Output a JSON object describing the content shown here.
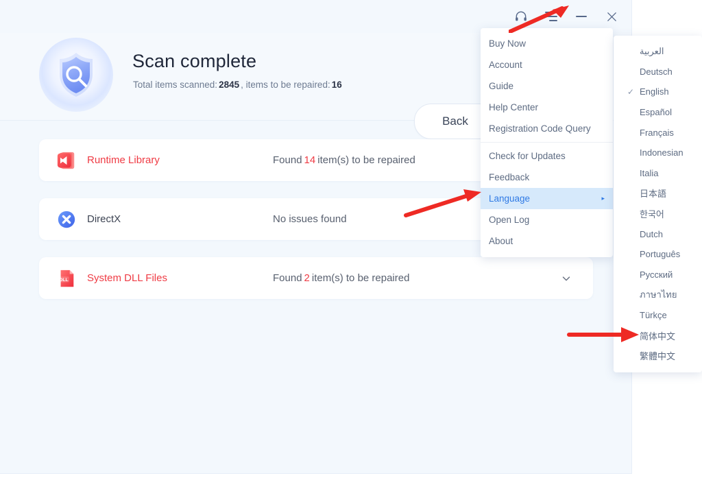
{
  "app": {
    "titlebar": {
      "support_icon": "headset-icon",
      "menu_icon": "hamburger-menu-icon",
      "minimize_icon": "minimize-icon",
      "close_icon": "close-icon"
    },
    "hero": {
      "logo_icon": "shield-scan-icon",
      "title": "Scan complete",
      "scanned_label": "Total items scanned:",
      "scanned_value": "2845",
      "comma": ",",
      "repair_label": "items to be repaired:",
      "repair_value": "16",
      "back_label": "Back"
    },
    "results": [
      {
        "icon": "visual-studio-runtime-icon",
        "name": "Runtime Library",
        "state": "alert",
        "status_prefix": "Found",
        "count": "14",
        "status_suffix": "item(s) to be repaired",
        "has_chevron": false
      },
      {
        "icon": "directx-icon",
        "name": "DirectX",
        "state": "ok",
        "status_prefix": "No issues found",
        "count": "",
        "status_suffix": "",
        "has_chevron": false
      },
      {
        "icon": "dll-file-icon",
        "name": "System DLL Files",
        "state": "alert",
        "status_prefix": "Found",
        "count": "2",
        "status_suffix": "item(s) to be repaired",
        "has_chevron": true,
        "chevron_icon": "chevron-down-icon"
      }
    ]
  },
  "menu": {
    "items": [
      {
        "label": "Buy Now",
        "active": false,
        "submenu": false
      },
      {
        "label": "Account",
        "active": false,
        "submenu": false
      },
      {
        "label": "Guide",
        "active": false,
        "submenu": false
      },
      {
        "label": "Help Center",
        "active": false,
        "submenu": false
      },
      {
        "label": "Registration Code Query",
        "active": false,
        "submenu": false
      },
      {
        "label": "Check for Updates",
        "active": false,
        "submenu": false
      },
      {
        "label": "Feedback",
        "active": false,
        "submenu": false
      },
      {
        "label": "Language",
        "active": true,
        "submenu": true,
        "arrow": "▸"
      },
      {
        "label": "Open Log",
        "active": false,
        "submenu": false
      },
      {
        "label": "About",
        "active": false,
        "submenu": false
      }
    ],
    "separator_after_index": 4
  },
  "language_submenu": {
    "checked": "English",
    "check_glyph": "✓",
    "items": [
      {
        "label": "العربية",
        "checked": false
      },
      {
        "label": "Deutsch",
        "checked": false
      },
      {
        "label": "English",
        "checked": true
      },
      {
        "label": "Español",
        "checked": false
      },
      {
        "label": "Français",
        "checked": false
      },
      {
        "label": "Indonesian",
        "checked": false
      },
      {
        "label": "Italia",
        "checked": false
      },
      {
        "label": "日本語",
        "checked": false
      },
      {
        "label": "한국어",
        "checked": false
      },
      {
        "label": "Dutch",
        "checked": false
      },
      {
        "label": "Português",
        "checked": false
      },
      {
        "label": "Русский",
        "checked": false
      },
      {
        "label": "ภาษาไทย",
        "checked": false
      },
      {
        "label": "Türkçe",
        "checked": false
      },
      {
        "label": "简体中文",
        "checked": false
      },
      {
        "label": "繁體中文",
        "checked": false
      }
    ]
  },
  "annotations": [
    {
      "name": "arrow-to-menu-button",
      "color": "#ee2a24"
    },
    {
      "name": "arrow-to-language-item",
      "color": "#ee2a24"
    },
    {
      "name": "arrow-to-simplified-chinese",
      "color": "#ee2a24"
    }
  ],
  "colors": {
    "accent_blue": "#2f7ae5",
    "alert_red": "#ef3b44",
    "annotation_red": "#ee2a24",
    "window_bg": "#f3f8fd",
    "card_bg": "#ffffff",
    "highlight_bg": "#d6e9fb"
  }
}
